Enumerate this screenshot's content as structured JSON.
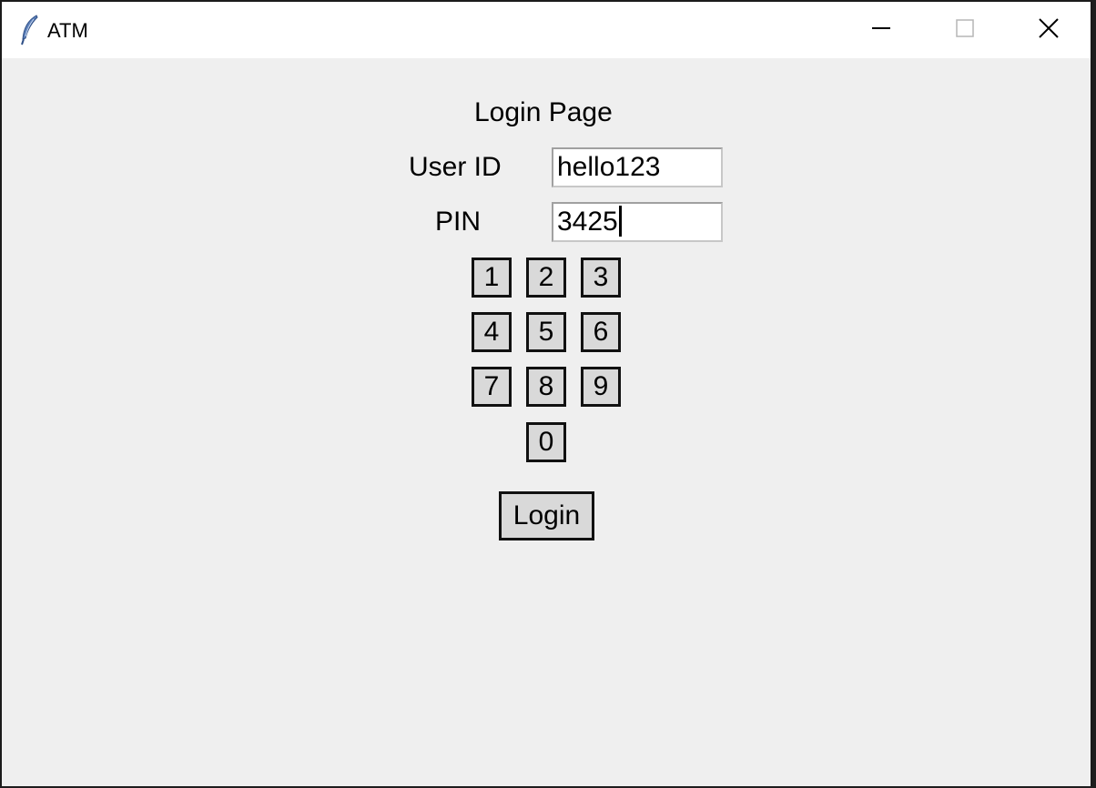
{
  "window": {
    "title": "ATM",
    "icon": "feather-icon",
    "controls": [
      "minimize-icon",
      "maximize-icon",
      "close-icon"
    ]
  },
  "form": {
    "heading": "Login Page",
    "user_id_label": "User ID",
    "user_id_value": "hello123",
    "pin_label": "PIN",
    "pin_value": "3425"
  },
  "keypad": {
    "keys": [
      "1",
      "2",
      "3",
      "4",
      "5",
      "6",
      "7",
      "8",
      "9",
      "0"
    ]
  },
  "login_button_label": "Login",
  "colors": {
    "window_background": "#efefef",
    "titlebar_background": "#ffffff",
    "button_face": "#d9d9d9",
    "button_border": "#111111"
  }
}
